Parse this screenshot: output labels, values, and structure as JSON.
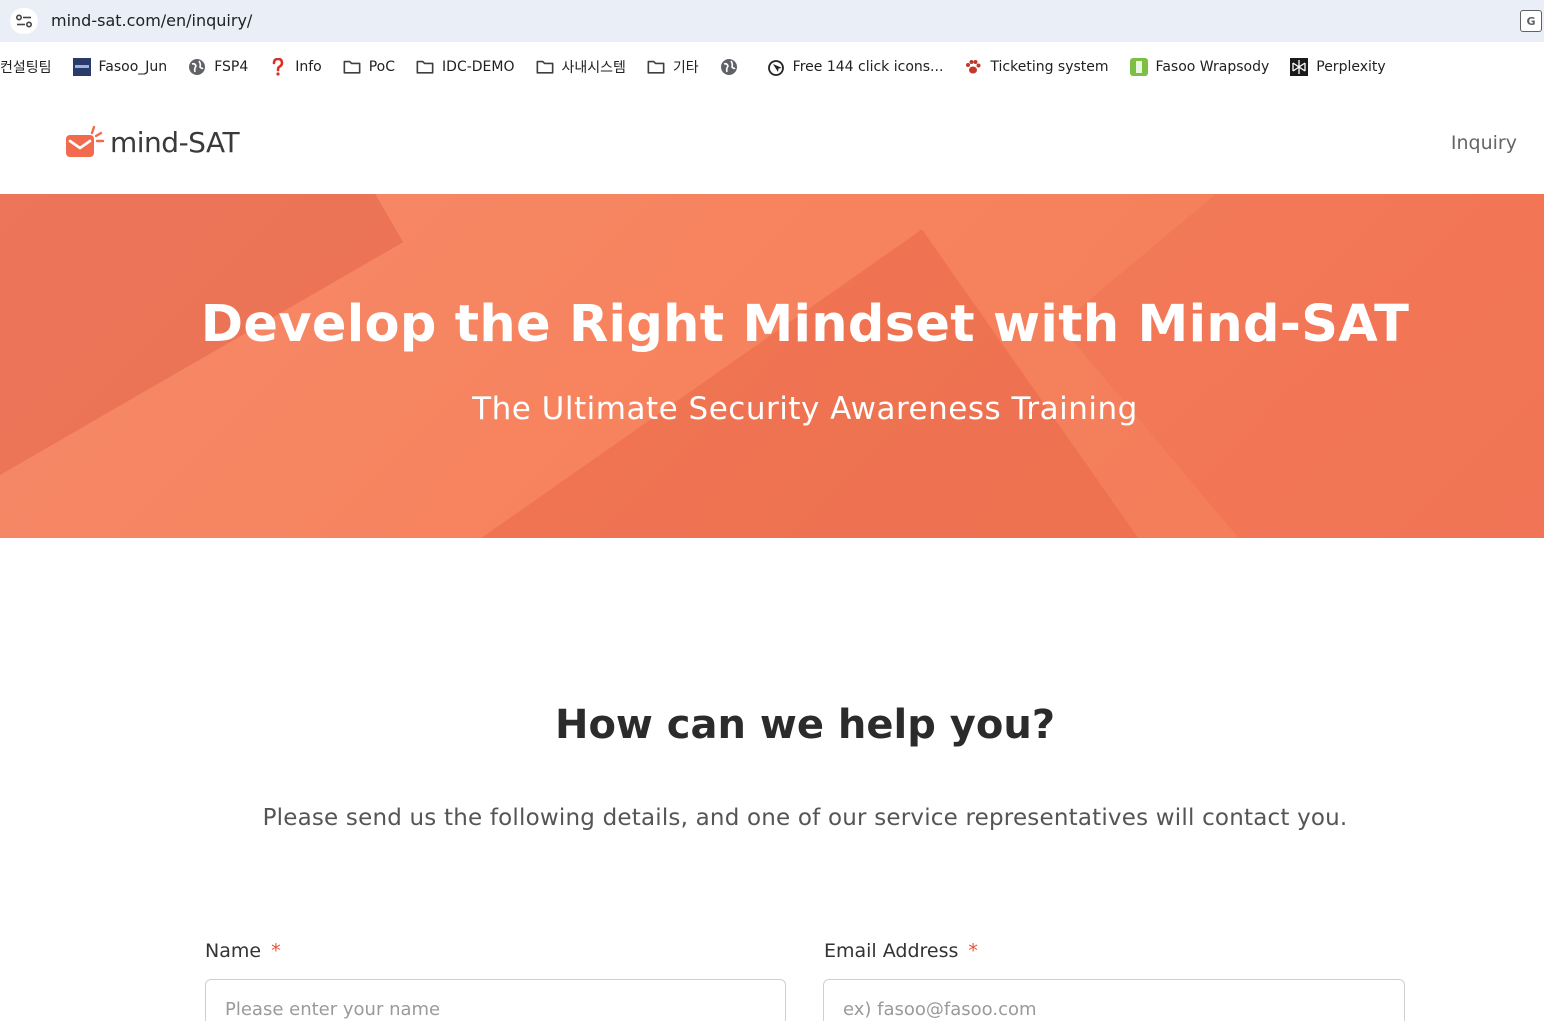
{
  "browser": {
    "url": "mind-sat.com/en/inquiry/"
  },
  "bookmarks": [
    {
      "label": "컨설팅팀",
      "icon": "none"
    },
    {
      "label": "Fasoo_Jun",
      "icon": "fasoo-favicon"
    },
    {
      "label": "FSP4",
      "icon": "globe-icon"
    },
    {
      "label": "Info",
      "icon": "question-icon"
    },
    {
      "label": "PoC",
      "icon": "folder-icon"
    },
    {
      "label": "IDC-DEMO",
      "icon": "folder-icon"
    },
    {
      "label": "사내시스템",
      "icon": "folder-icon"
    },
    {
      "label": "기타",
      "icon": "folder-icon"
    },
    {
      "label": "",
      "icon": "globe-icon"
    },
    {
      "label": "Free 144 click icons...",
      "icon": "click-icon"
    },
    {
      "label": "Ticketing system",
      "icon": "paw-icon"
    },
    {
      "label": "Fasoo Wrapsody",
      "icon": "wrapsody-icon"
    },
    {
      "label": "Perplexity",
      "icon": "perplexity-icon"
    }
  ],
  "header": {
    "logo_text": "mind-SAT",
    "nav_inquiry": "Inquiry"
  },
  "hero": {
    "title": "Develop the Right Mindset with Mind-SAT",
    "subtitle": "The Ultimate Security Awareness Training"
  },
  "main": {
    "title": "How can we help you?",
    "subtitle": "Please send us the following details, and one of our service representatives will contact you."
  },
  "form": {
    "name_label": "Name",
    "name_required": "*",
    "name_placeholder": "Please enter your name",
    "email_label": "Email Address",
    "email_required": "*",
    "email_placeholder": "ex) fasoo@fasoo.com"
  },
  "colors": {
    "accent": "#f47c5c",
    "required": "#e8543a"
  }
}
